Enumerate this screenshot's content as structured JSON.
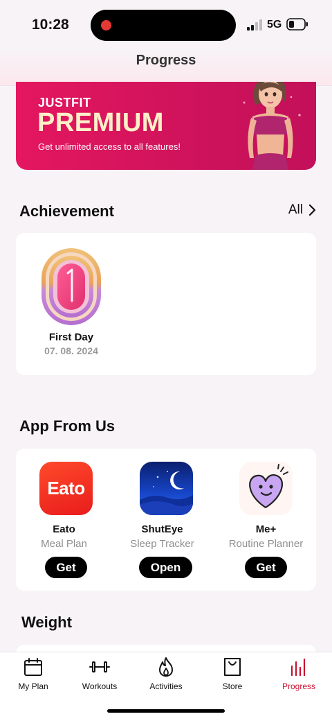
{
  "status": {
    "time": "10:28",
    "network": "5G"
  },
  "header": {
    "title": "Progress"
  },
  "premium": {
    "brand": "JUSTFIT",
    "title": "PREMIUM",
    "subtitle": "Get unlimited access to all features!"
  },
  "achievement": {
    "title": "Achievement",
    "see_all": "All",
    "badges": [
      {
        "name": "First Day",
        "date": "07. 08. 2024",
        "number": "1"
      }
    ]
  },
  "apps": {
    "title": "App From Us",
    "items": [
      {
        "name": "Eato",
        "desc": "Meal Plan",
        "button": "Get",
        "icon": "eato-app-icon",
        "logo": "Eato"
      },
      {
        "name": "ShutEye",
        "desc": "Sleep Tracker",
        "button": "Open",
        "icon": "shuteye-app-icon"
      },
      {
        "name": "Me+",
        "desc": "Routine Planner",
        "button": "Get",
        "icon": "meplus-app-icon"
      }
    ]
  },
  "weight": {
    "title": "Weight"
  },
  "tabs": [
    {
      "label": "My Plan",
      "icon": "calendar-icon",
      "active": false
    },
    {
      "label": "Workouts",
      "icon": "dumbbell-icon",
      "active": false
    },
    {
      "label": "Activities",
      "icon": "flame-icon",
      "active": false
    },
    {
      "label": "Store",
      "icon": "shopping-bag-icon",
      "active": false
    },
    {
      "label": "Progress",
      "icon": "bar-chart-icon",
      "active": true
    }
  ],
  "colors": {
    "accent": "#c8102e",
    "banner": "#e4175f",
    "banner_title": "#fdf0c8"
  }
}
